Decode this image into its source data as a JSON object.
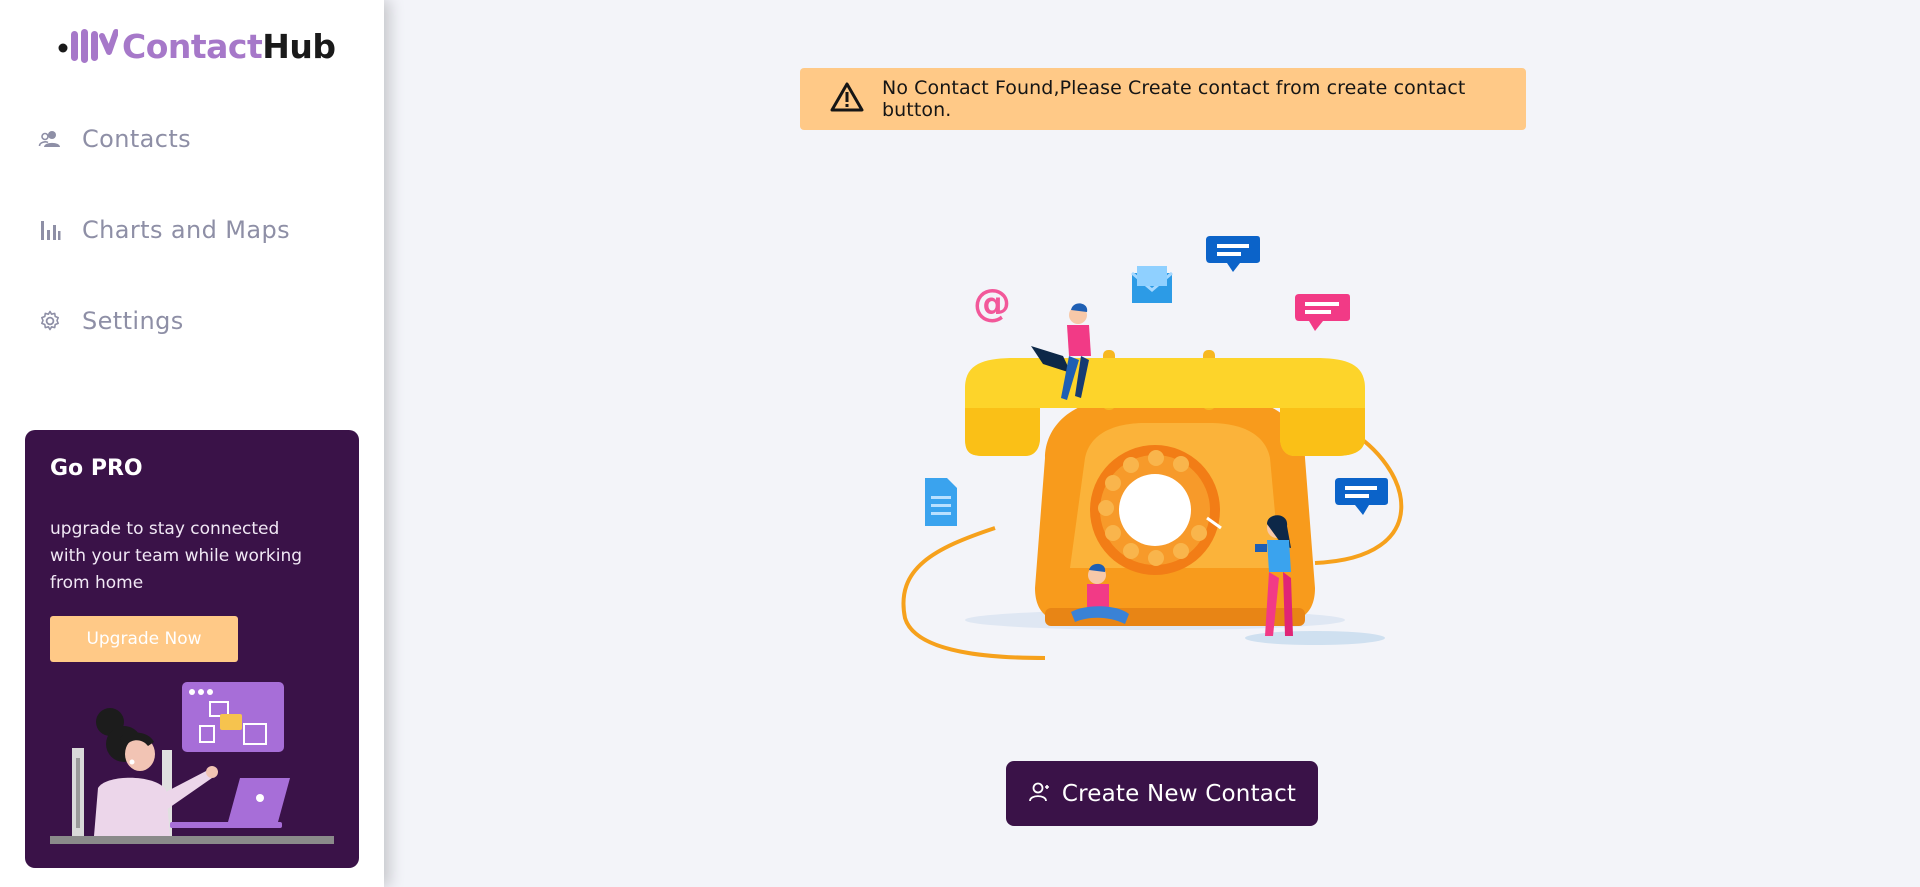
{
  "brand": {
    "name_part1": "Contact",
    "name_part2": "Hub"
  },
  "sidebar": {
    "items": [
      {
        "label": "Contacts",
        "icon": "users-icon"
      },
      {
        "label": "Charts and Maps",
        "icon": "bar-chart-icon"
      },
      {
        "label": "Settings",
        "icon": "gear-icon"
      }
    ]
  },
  "promo": {
    "title": "Go PRO",
    "text": "upgrade to stay connected with your team while working from home",
    "button_label": "Upgrade Now"
  },
  "alert": {
    "icon": "warning-icon",
    "message": "No Contact Found,Please Create contact from create contact button."
  },
  "main": {
    "create_button_label": "Create New Contact",
    "create_button_icon": "user-add-icon"
  },
  "colors": {
    "accent": "#3a1248",
    "warning_bg": "#ffc987",
    "logo_purple": "#a678c9",
    "nav_text": "#8e8fa6",
    "background": "#f3f4f9"
  }
}
